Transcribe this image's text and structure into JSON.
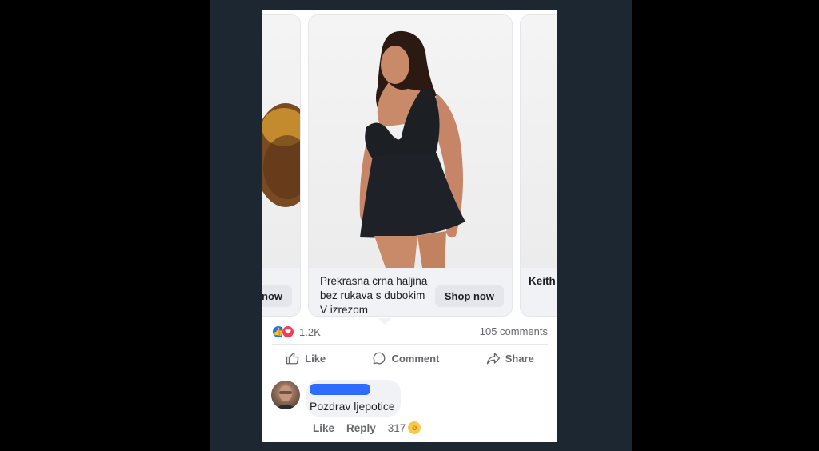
{
  "carousel": {
    "left_card": {
      "button": "now"
    },
    "main_card": {
      "title": "Prekrasna crna haljina bez rukava s dubokim V izrezom",
      "button": "Shop now"
    },
    "right_card": {
      "title": "Keith T-shir"
    }
  },
  "reactions": {
    "count": "1.2K",
    "comments": "105 comments"
  },
  "actions": {
    "like": "Like",
    "comment": "Comment",
    "share": "Share"
  },
  "comment": {
    "text": "Pozdrav ljepotice",
    "like": "Like",
    "reply": "Reply",
    "reaction_count": "317"
  },
  "colors": {
    "background_frame": "#1c2731",
    "like_blue": "#1877f2",
    "love_red": "#f33e58",
    "redaction_blue": "#2f6bff"
  },
  "icons": [
    "like-reaction-icon",
    "love-reaction-icon",
    "thumbs-up-icon",
    "comment-icon",
    "share-icon",
    "laugh-reaction-icon"
  ]
}
